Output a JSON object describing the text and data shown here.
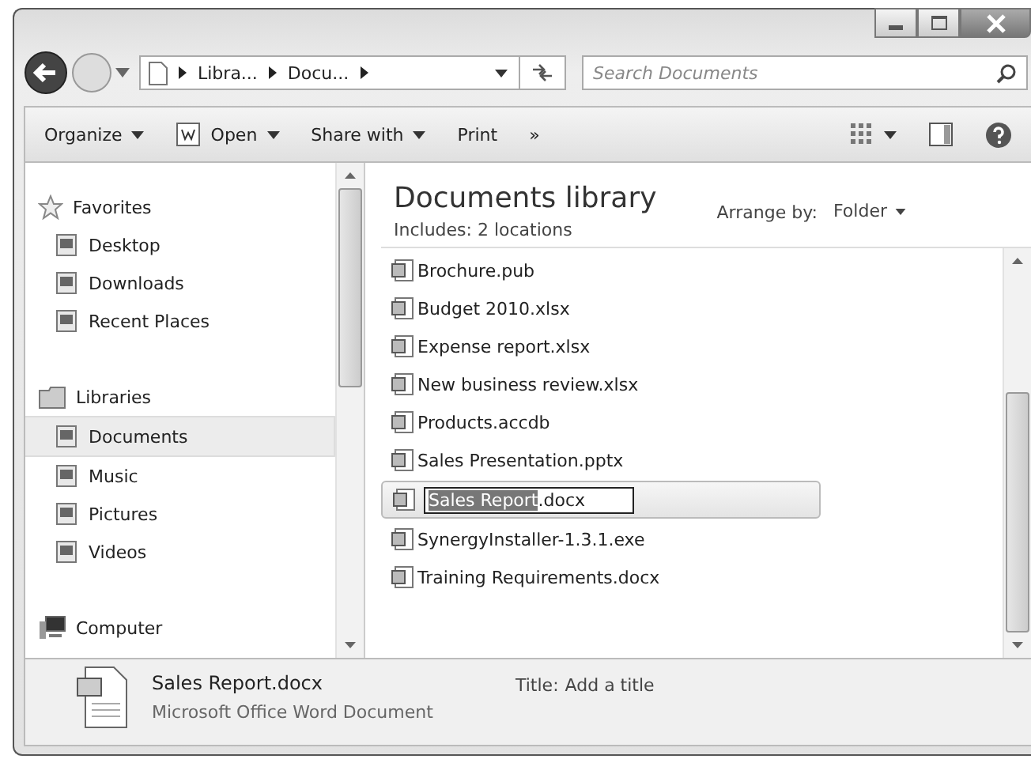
{
  "address": {
    "crumbs": [
      "Libra...",
      "Docu..."
    ]
  },
  "search": {
    "placeholder": "Search Documents"
  },
  "toolbar": [
    {
      "label": "Organize",
      "kind": "menu"
    },
    {
      "label": "Open",
      "kind": "open"
    },
    {
      "label": "Share with",
      "kind": "menu"
    },
    {
      "label": "Print",
      "kind": "plain"
    },
    {
      "label": "»",
      "kind": "plain"
    }
  ],
  "sidebar": {
    "groups": [
      {
        "label": "Favorites",
        "kind": "star",
        "children": [
          {
            "label": "Desktop",
            "selected": false
          },
          {
            "label": "Downloads",
            "selected": false
          },
          {
            "label": "Recent Places",
            "selected": false
          }
        ]
      },
      {
        "label": "Libraries",
        "kind": "library",
        "children": [
          {
            "label": "Documents",
            "selected": true
          },
          {
            "label": "Music",
            "selected": false
          },
          {
            "label": "Pictures",
            "selected": false
          },
          {
            "label": "Videos",
            "selected": false
          }
        ]
      },
      {
        "label": "Computer",
        "kind": "computer"
      }
    ]
  },
  "library": {
    "title": "Documents library",
    "subtitle": "Includes:  2 locations",
    "arrange_label": "Arrange by:",
    "arrange_value": "Folder"
  },
  "files": [
    {
      "kind": "file",
      "name": "Brochure.pub"
    },
    {
      "kind": "file",
      "name": "Budget 2010.xlsx"
    },
    {
      "kind": "file",
      "name": "Expense report.xlsx"
    },
    {
      "kind": "file",
      "name": "New business review.xlsx"
    },
    {
      "kind": "file",
      "name": "Products.accdb"
    },
    {
      "kind": "file",
      "name": "Sales Presentation.pptx"
    },
    {
      "kind": "rename",
      "name_selected": "Sales Report",
      "name_rest": ".docx"
    },
    {
      "kind": "file",
      "name": "SynergyInstaller-1.3.1.exe"
    },
    {
      "kind": "file",
      "name": "Training Requirements.docx"
    }
  ],
  "details": {
    "name": "Sales Report.docx",
    "type": "Microsoft Office Word Document",
    "title_label": "Title:",
    "title_value": "Add a title"
  }
}
